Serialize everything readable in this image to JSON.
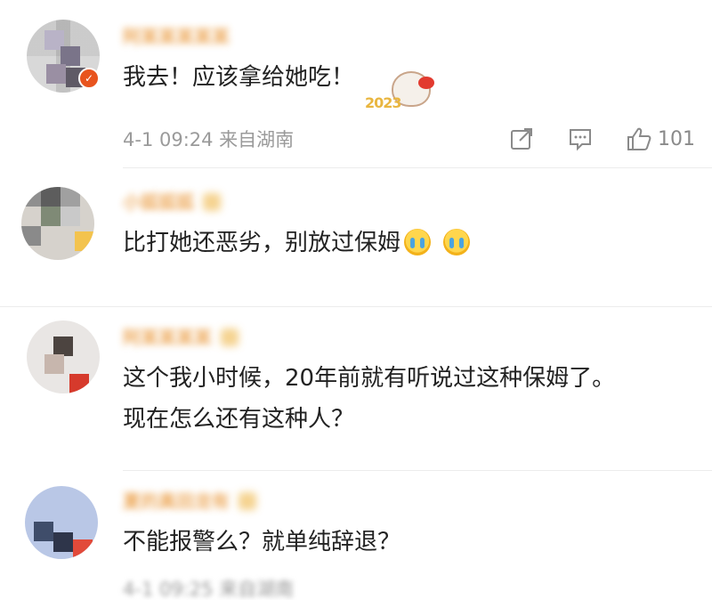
{
  "comments": [
    {
      "username": "阿某某某某某",
      "text": "我去！应该拿给她吃！",
      "sticker_text": "2023",
      "meta": "4-1 09:24 来自湖南",
      "like_count": "101"
    },
    {
      "username": "小狐狐狐",
      "text": "比打她还恶劣，别放过保姆"
    },
    {
      "username": "阿某某某某",
      "text_line1": "这个我小时候，20年前就有听说过这种保姆了。",
      "text_line2": "现在怎么还有这种人？"
    },
    {
      "username": "夏的真田龙有",
      "text": "不能报警么？就单纯辞退？",
      "meta": "4-1 09:25 来自湖南"
    }
  ],
  "icons": {
    "share": "share-icon",
    "comment": "comment-icon",
    "like": "thumbs-up-icon",
    "crying_emoji": "crying-face-emoji"
  },
  "colors": {
    "username_orange": "#e8912d",
    "badge_orange": "#e8541e",
    "meta_gray": "#9a9a9a",
    "text": "#222222"
  }
}
